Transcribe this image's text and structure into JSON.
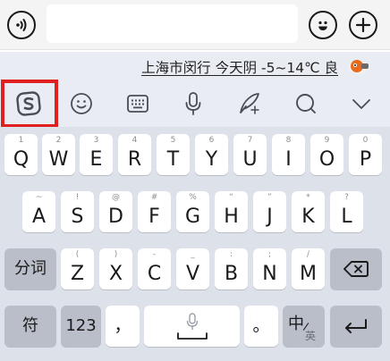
{
  "top_bar": {
    "voice_icon": "voice-wave-icon",
    "emoji_icon": "emoji-face-icon",
    "plus_icon": "plus-icon",
    "input_value": ""
  },
  "weather": {
    "text": "上海市闵行 今天阴 -5~14℃ 良"
  },
  "toolbar": {
    "items": [
      "sogou-logo-icon",
      "emoji-icon",
      "keyboard-icon",
      "microphone-icon",
      "handwriting-icon",
      "search-icon",
      "collapse-chevron-icon"
    ]
  },
  "keyboard": {
    "row1": [
      {
        "key": "Q",
        "sub": "1"
      },
      {
        "key": "W",
        "sub": "2"
      },
      {
        "key": "E",
        "sub": "3"
      },
      {
        "key": "R",
        "sub": "4"
      },
      {
        "key": "T",
        "sub": "5"
      },
      {
        "key": "Y",
        "sub": "6"
      },
      {
        "key": "U",
        "sub": "7"
      },
      {
        "key": "I",
        "sub": "8"
      },
      {
        "key": "O",
        "sub": "9"
      },
      {
        "key": "P",
        "sub": "0"
      }
    ],
    "row2": [
      {
        "key": "A",
        "sub": "~"
      },
      {
        "key": "S",
        "sub": "!"
      },
      {
        "key": "D",
        "sub": "@"
      },
      {
        "key": "F",
        "sub": "#"
      },
      {
        "key": "G",
        "sub": "%"
      },
      {
        "key": "H",
        "sub": "“"
      },
      {
        "key": "J",
        "sub": "”"
      },
      {
        "key": "K",
        "sub": "*"
      },
      {
        "key": "L",
        "sub": "?"
      }
    ],
    "row3": [
      {
        "key": "Z",
        "sub": "("
      },
      {
        "key": "X",
        "sub": ")"
      },
      {
        "key": "C",
        "sub": "-"
      },
      {
        "key": "V",
        "sub": "_"
      },
      {
        "key": "B",
        "sub": ":"
      },
      {
        "key": "N",
        "sub": ";"
      },
      {
        "key": "M",
        "sub": "/"
      }
    ],
    "segment_key": "分词",
    "symbol_key": "符",
    "number_key": "123",
    "comma_key": "，",
    "period_key": "。",
    "lang_main": "中",
    "lang_sub": "英",
    "space_icon": "microphone-icon",
    "backspace_icon": "backspace-icon",
    "enter_icon": "enter-icon"
  },
  "colors": {
    "highlight": "#e02020",
    "keyboard_bg": "#dde1ea",
    "function_key": "#b9bec9"
  }
}
